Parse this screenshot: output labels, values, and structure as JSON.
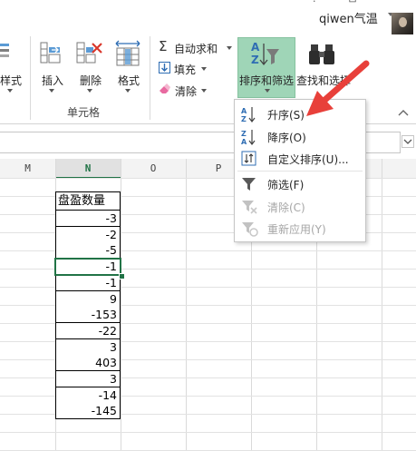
{
  "window": {
    "buttons": [
      "?",
      "⊡",
      "—"
    ],
    "user_name": "qiwen气温"
  },
  "ribbon": {
    "style_label": "样式",
    "insert_label": "插入",
    "delete_label": "删除",
    "format_label": "格式",
    "cells_group_label": "单元格",
    "autosum_label": "自动求和",
    "fill_label": "填充",
    "clear_label": "清除",
    "sort_filter_label": "排序和筛选",
    "find_select_label": "查找和选择"
  },
  "sort_menu": {
    "items": [
      {
        "label": "升序(S)",
        "icon": "sort-ascending-icon",
        "enabled": true
      },
      {
        "label": "降序(O)",
        "icon": "sort-descending-icon",
        "enabled": true
      },
      {
        "label": "自定义排序(U)...",
        "icon": "custom-sort-icon",
        "enabled": true
      },
      {
        "label": "筛选(F)",
        "icon": "filter-icon",
        "enabled": true
      },
      {
        "label": "清除(C)",
        "icon": "clear-filter-icon",
        "enabled": false
      },
      {
        "label": "重新应用(Y)",
        "icon": "reapply-filter-icon",
        "enabled": false
      }
    ]
  },
  "grid": {
    "columns": [
      "M",
      "N",
      "O",
      "P"
    ],
    "active_column": "N",
    "table_header": "盘盈数量",
    "values": [
      "-3",
      "-2",
      "-5",
      "-1",
      "-1",
      "9",
      "-153",
      "-22",
      "3",
      "403",
      "3",
      "-14",
      "-145"
    ]
  },
  "colors": {
    "accent": "#217346",
    "highlight": "#9fd5b7",
    "arrow": "#e8403a"
  }
}
